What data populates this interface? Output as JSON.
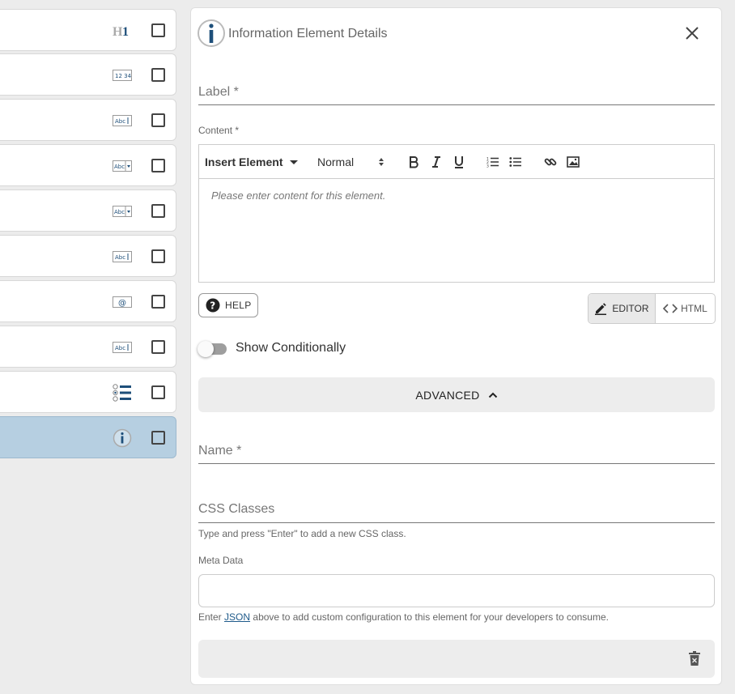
{
  "list": {
    "rows": [
      {
        "icon": "heading-icon",
        "selected": false
      },
      {
        "icon": "number-input-icon",
        "selected": false
      },
      {
        "icon": "text-input-icon",
        "selected": false
      },
      {
        "icon": "dropdown-icon",
        "selected": false
      },
      {
        "icon": "dropdown-icon",
        "selected": false
      },
      {
        "icon": "text-input-icon",
        "selected": false
      },
      {
        "icon": "email-input-icon",
        "selected": false
      },
      {
        "icon": "text-input-icon",
        "selected": false
      },
      {
        "icon": "radio-list-icon",
        "selected": false
      },
      {
        "icon": "info-icon",
        "selected": true
      }
    ]
  },
  "panel": {
    "title": "Information Element Details",
    "label_field": {
      "label": "Label *"
    },
    "content_label": "Content *",
    "editor": {
      "insert_element": "Insert Element",
      "format": "Normal",
      "placeholder": "Please enter content for this element."
    },
    "help_label": "HELP",
    "mode": {
      "editor": "EDITOR",
      "html": "HTML",
      "active": "editor"
    },
    "show_conditionally": {
      "label": "Show Conditionally",
      "on": false
    },
    "advanced_label": "ADVANCED",
    "name_field": {
      "label": "Name *"
    },
    "css_field": {
      "label": "CSS Classes",
      "hint": "Type and press \"Enter\" to add a new CSS class."
    },
    "meta": {
      "label": "Meta Data",
      "value": "",
      "hint_before": "Enter",
      "hint_link": "JSON",
      "hint_after": "above to add custom configuration to this element for your developers to consume."
    }
  },
  "colors": {
    "accent": "#1e4f7a",
    "selected_row": "#b6cfe1"
  }
}
